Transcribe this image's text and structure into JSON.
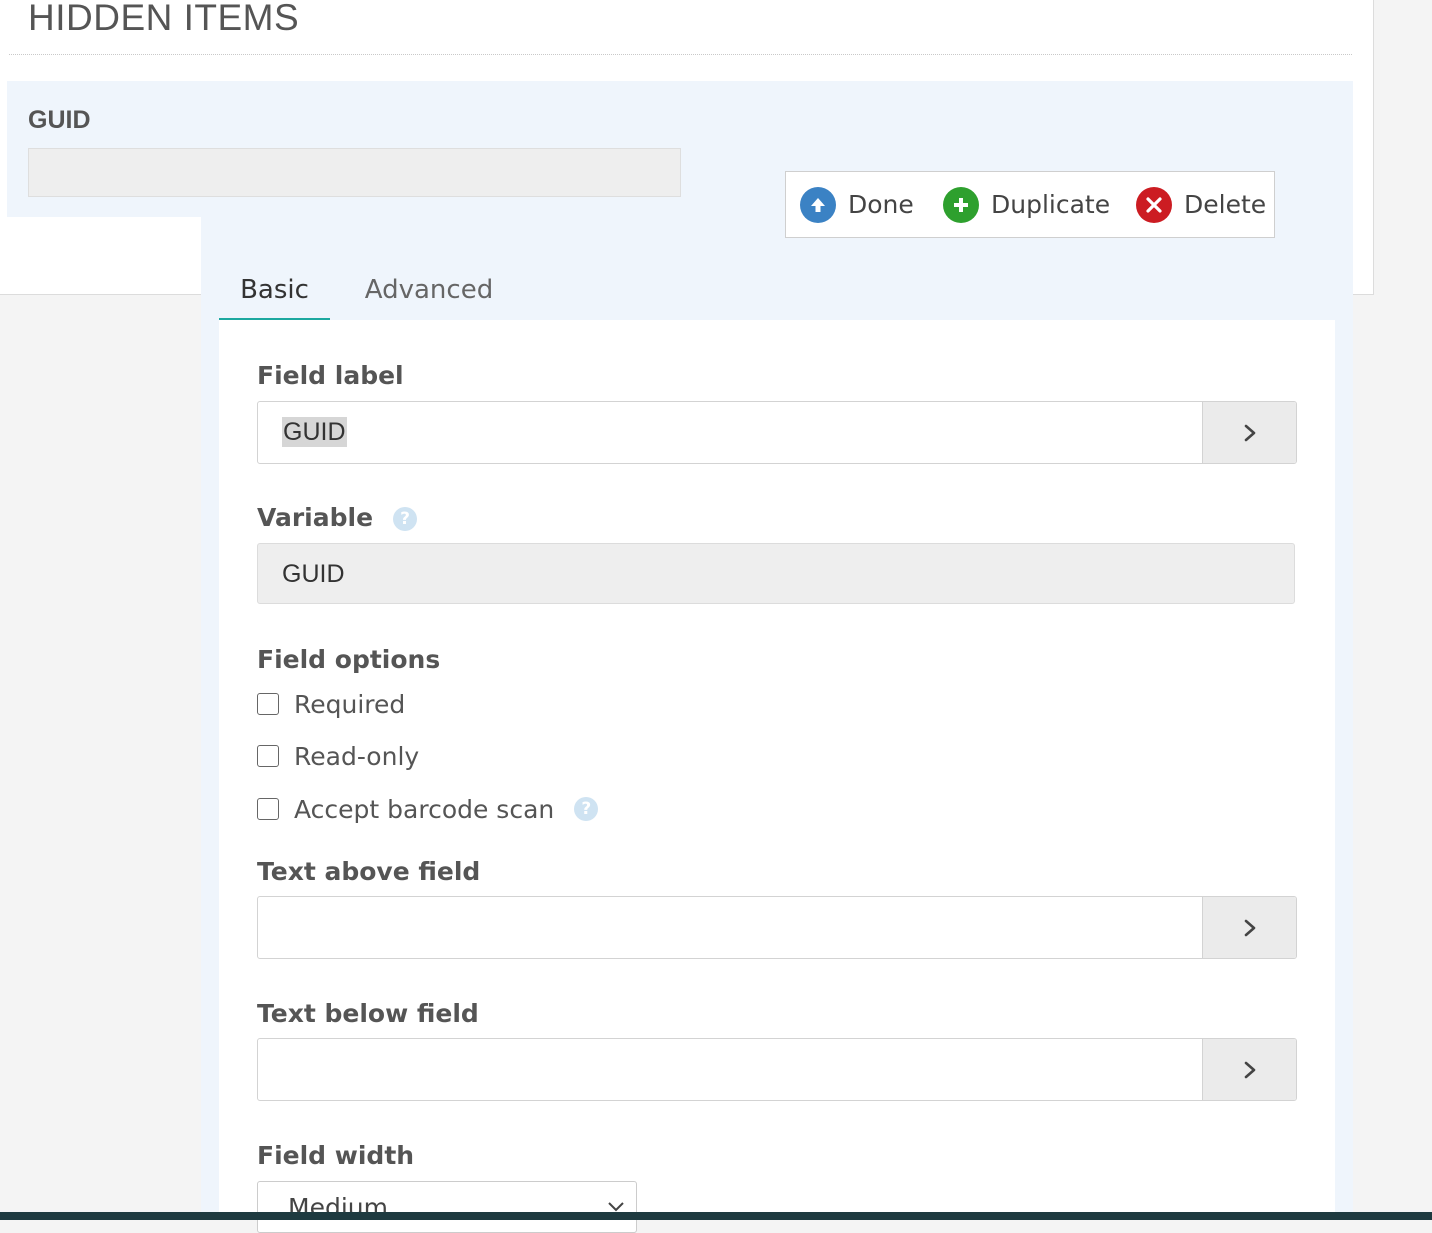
{
  "section": {
    "title": "HIDDEN ITEMS"
  },
  "field_header": {
    "name": "GUID"
  },
  "toolbar": {
    "done_label": "Done",
    "duplicate_label": "Duplicate",
    "delete_label": "Delete"
  },
  "tabs": [
    {
      "label": "Basic",
      "active": true
    },
    {
      "label": "Advanced",
      "active": false
    }
  ],
  "form": {
    "field_label": {
      "label": "Field label",
      "value": "GUID"
    },
    "variable": {
      "label": "Variable",
      "value": "GUID"
    },
    "field_options": {
      "label": "Field options",
      "options": [
        {
          "label": "Required",
          "checked": false
        },
        {
          "label": "Read-only",
          "checked": false
        },
        {
          "label": "Accept barcode scan",
          "checked": false
        }
      ]
    },
    "text_above": {
      "label": "Text above field",
      "value": ""
    },
    "text_below": {
      "label": "Text below field",
      "value": ""
    },
    "field_width": {
      "label": "Field width",
      "selected": "Medium"
    }
  },
  "icons": {
    "done": "arrow-up-circle-icon",
    "duplicate": "plus-circle-icon",
    "delete": "x-circle-icon",
    "expand": "chevron-right-icon",
    "help": "question-circle-icon"
  },
  "colors": {
    "done": "#3b82c4",
    "duplicate": "#2ea02e",
    "delete": "#cc1c22",
    "tab_accent": "#1ca8a0",
    "panel_bg": "#eff5fc"
  }
}
